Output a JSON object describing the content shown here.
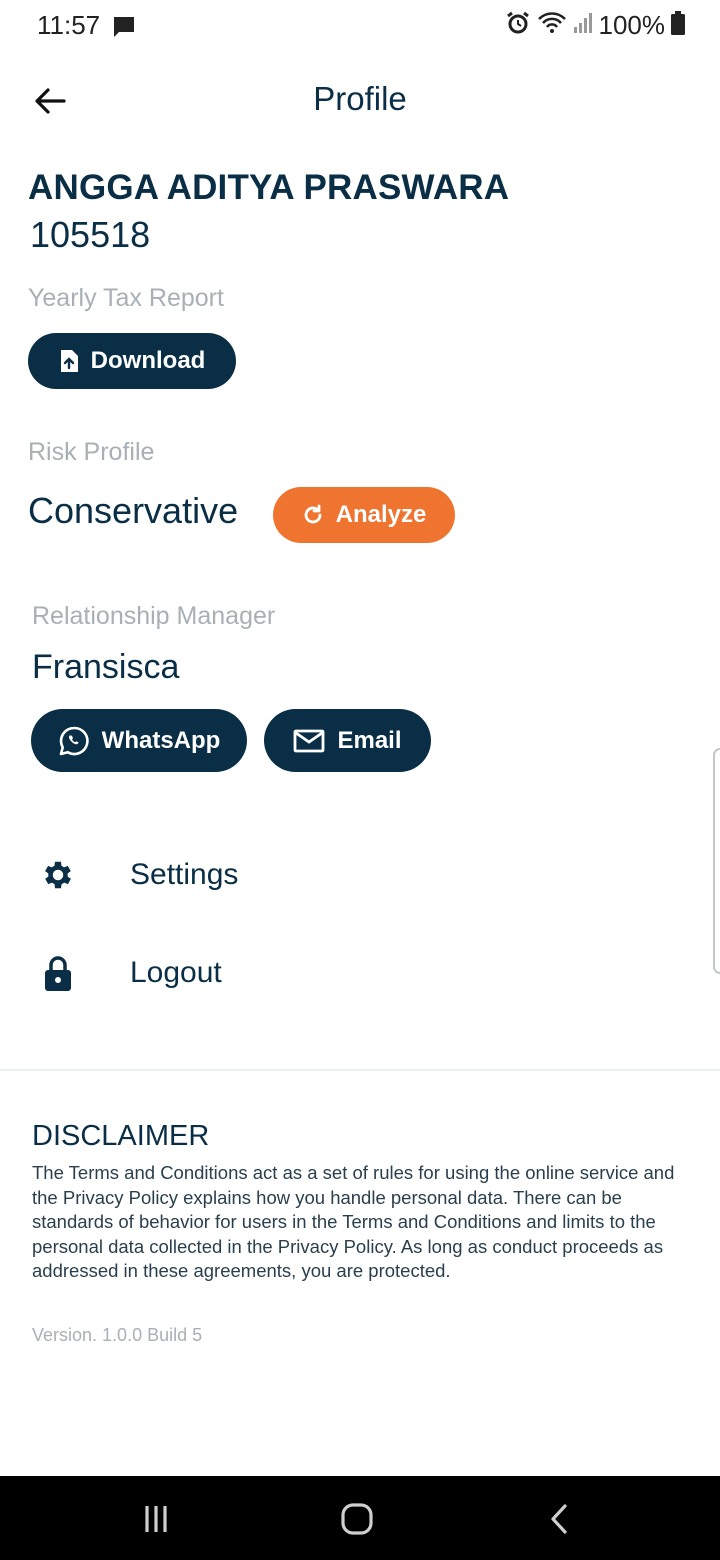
{
  "status": {
    "time": "11:57",
    "battery": "100%",
    "icons": [
      "message-icon",
      "alarm-icon",
      "wifi-icon",
      "signal-icon",
      "battery-icon"
    ]
  },
  "header": {
    "title": "Profile",
    "back_icon": "arrow-left-icon"
  },
  "user": {
    "name": "ANGGA ADITYA PRASWARA",
    "id": "105518"
  },
  "tax": {
    "label": "Yearly Tax Report",
    "button": "Download",
    "icon": "file-upload-icon"
  },
  "risk": {
    "label": "Risk Profile",
    "value": "Conservative",
    "button": "Analyze",
    "icon": "refresh-icon"
  },
  "manager": {
    "label": "Relationship Manager",
    "name": "Fransisca",
    "whatsapp": "WhatsApp",
    "email": "Email"
  },
  "menu": {
    "settings": "Settings",
    "logout": "Logout"
  },
  "disclaimer": {
    "title": "DISCLAIMER",
    "text": "The Terms and Conditions act as a set of rules for using the online service and the Privacy Policy explains how you handle personal data. There can be standards of behavior for users in the Terms and Conditions and limits to the personal data collected in the Privacy Policy. As long as conduct proceeds as addressed in these agreements, you are protected."
  },
  "version": "Version. 1.0.0 Build 5",
  "colors": {
    "primary": "#0a2e45",
    "accent": "#ee7430",
    "muted": "#a8b0b6"
  }
}
